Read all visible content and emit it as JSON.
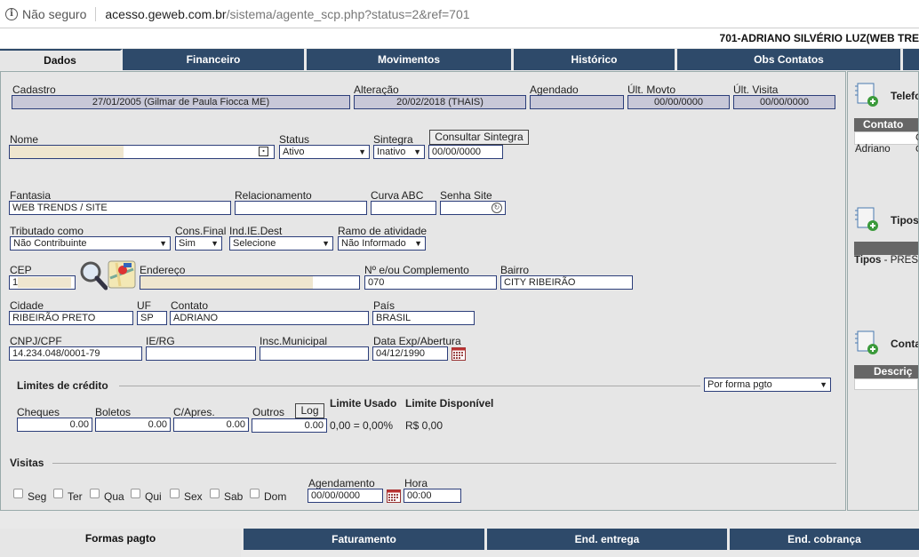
{
  "browser": {
    "security_label": "Não seguro",
    "url_domain": "acesso.geweb.com.br",
    "url_path": "/sistema/agente_scp.php?status=2&ref=701"
  },
  "agent_title": "701-ADRIANO SILVÉRIO LUZ(WEB TRE",
  "top_tabs": [
    "Dados",
    "Financeiro",
    "Movimentos",
    "Histórico",
    "Obs Contatos"
  ],
  "header_row": {
    "cadastro_label": "Cadastro",
    "cadastro_value": "27/01/2005 (Gilmar de Paula Fiocca ME)",
    "alteracao_label": "Alteração",
    "alteracao_value": "20/02/2018 (THAIS)",
    "agendado_label": "Agendado",
    "agendado_value": "",
    "ult_movto_label": "Últ. Movto",
    "ult_movto_value": "00/00/0000",
    "ult_visita_label": "Últ. Visita",
    "ult_visita_value": "00/00/0000"
  },
  "form": {
    "nome_label": "Nome",
    "status_label": "Status",
    "status_value": "Ativo",
    "sintegra_label": "Sintegra",
    "sintegra_value": "Inativo",
    "consultar_sintegra": "Consultar Sintegra",
    "sintegra_date": "00/00/0000",
    "fantasia_label": "Fantasia",
    "fantasia_value": "WEB TRENDS / SITE",
    "relacionamento_label": "Relacionamento",
    "curva_label": "Curva ABC",
    "senha_label": "Senha Site",
    "tributado_label": "Tributado como",
    "tributado_value": "Não Contribuinte",
    "consfinal_label": "Cons.Final",
    "consfinal_value": "Sim",
    "indie_label": "Ind.IE.Dest",
    "indie_value": "Selecione",
    "ramo_label": "Ramo de atividade",
    "ramo_value": "Não Informado",
    "cep_label": "CEP",
    "cep_value": "1",
    "endereco_label": "Endereço",
    "numero_label": "Nº e/ou Complemento",
    "numero_value": "070",
    "bairro_label": "Bairro",
    "bairro_value": "CITY RIBEIRÃO",
    "cidade_label": "Cidade",
    "cidade_value": "RIBEIRÃO PRETO",
    "uf_label": "UF",
    "uf_value": "SP",
    "contato_label": "Contato",
    "contato_value": "ADRIANO",
    "pais_label": "País",
    "pais_value": "BRASIL",
    "cnpj_label": "CNPJ/CPF",
    "cnpj_value": "14.234.048/0001-79",
    "ierg_label": "IE/RG",
    "inscmun_label": "Insc.Municipal",
    "dataexp_label": "Data Exp/Abertura",
    "dataexp_value": "04/12/1990"
  },
  "credito": {
    "title": "Limites de crédito",
    "forma_select": "Por forma pgto",
    "cheques_label": "Cheques",
    "cheques_value": "0.00",
    "boletos_label": "Boletos",
    "boletos_value": "0.00",
    "capres_label": "C/Apres.",
    "capres_value": "0.00",
    "outros_label": "Outros",
    "outros_value": "0.00",
    "log_button": "Log",
    "limite_usado_label": "Limite Usado",
    "limite_disp_label": "Limite Disponível",
    "usado_value": "0,00 = 0,00%",
    "disp_value": "R$ 0,00"
  },
  "visitas": {
    "title": "Visitas",
    "days": [
      "Seg",
      "Ter",
      "Qua",
      "Qui",
      "Sex",
      "Sab",
      "Dom"
    ],
    "agendamento_label": "Agendamento",
    "agendamento_value": "00/00/0000",
    "hora_label": "Hora",
    "hora_value": "00:00"
  },
  "side": {
    "telefones": "Telefo",
    "contato_hdr": "Contato",
    "contato_col2": "C",
    "contato_row": "Adriano",
    "contato_row_col2": "C",
    "tipos": "Tipos",
    "tipos_line_label": "Tipos",
    "tipos_line_value": " - PRES",
    "contas": "Conta",
    "descricao_hdr": "Descriç"
  },
  "bottom_tabs": [
    "Formas pagto",
    "Faturamento",
    "End. entrega",
    "End. cobrança"
  ],
  "colors": {
    "tab_blue": "#2e4a6a",
    "field_border": "#2c3e7a",
    "readonly_bg": "#c8c8d8"
  }
}
